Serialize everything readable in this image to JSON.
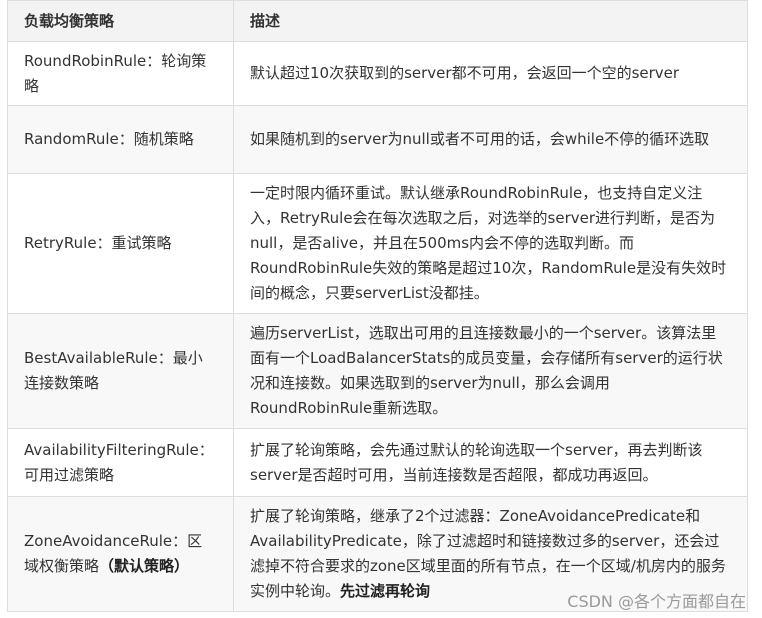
{
  "table": {
    "headers": [
      "负载均衡策略",
      "描述"
    ],
    "rows": [
      {
        "strategy": "RoundRobinRule：轮询策略",
        "description": "默认超过10次获取到的server都不可用，会返回一个空的server"
      },
      {
        "strategy": "RandomRule：随机策略",
        "description": "如果随机到的server为null或者不可用的话，会while不停的循环选取"
      },
      {
        "strategy": "RetryRule：重试策略",
        "description": "一定时限内循环重试。默认继承RoundRobinRule，也支持自定义注入，RetryRule会在每次选取之后，对选举的server进行判断，是否为null，是否alive，并且在500ms内会不停的选取判断。而RoundRobinRule失效的策略是超过10次，RandomRule是没有失效时间的概念，只要serverList没都挂。"
      },
      {
        "strategy": "BestAvailableRule：最小连接数策略",
        "description": "遍历serverList，选取出可用的且连接数最小的一个server。该算法里面有一个LoadBalancerStats的成员变量，会存储所有server的运行状况和连接数。如果选取到的server为null，那么会调用RoundRobinRule重新选取。"
      },
      {
        "strategy": "AvailabilityFilteringRule：可用过滤策略",
        "description": "扩展了轮询策略，会先通过默认的轮询选取一个server，再去判断该server是否超时可用，当前连接数是否超限，都成功再返回。"
      },
      {
        "strategy": "ZoneAvoidanceRule：区域权衡策略",
        "strategy_bold": "（默认策略）",
        "description": "扩展了轮询策略，继承了2个过滤器：ZoneAvoidancePredicate和AvailabilityPredicate，除了过滤超时和链接数过多的server，还会过滤掉不符合要求的zone区域里面的所有节点，在一个区域/机房内的服务实例中轮询。",
        "description_bold": "先过滤再轮询"
      }
    ]
  },
  "watermark": "CSDN @各个方面都自在"
}
